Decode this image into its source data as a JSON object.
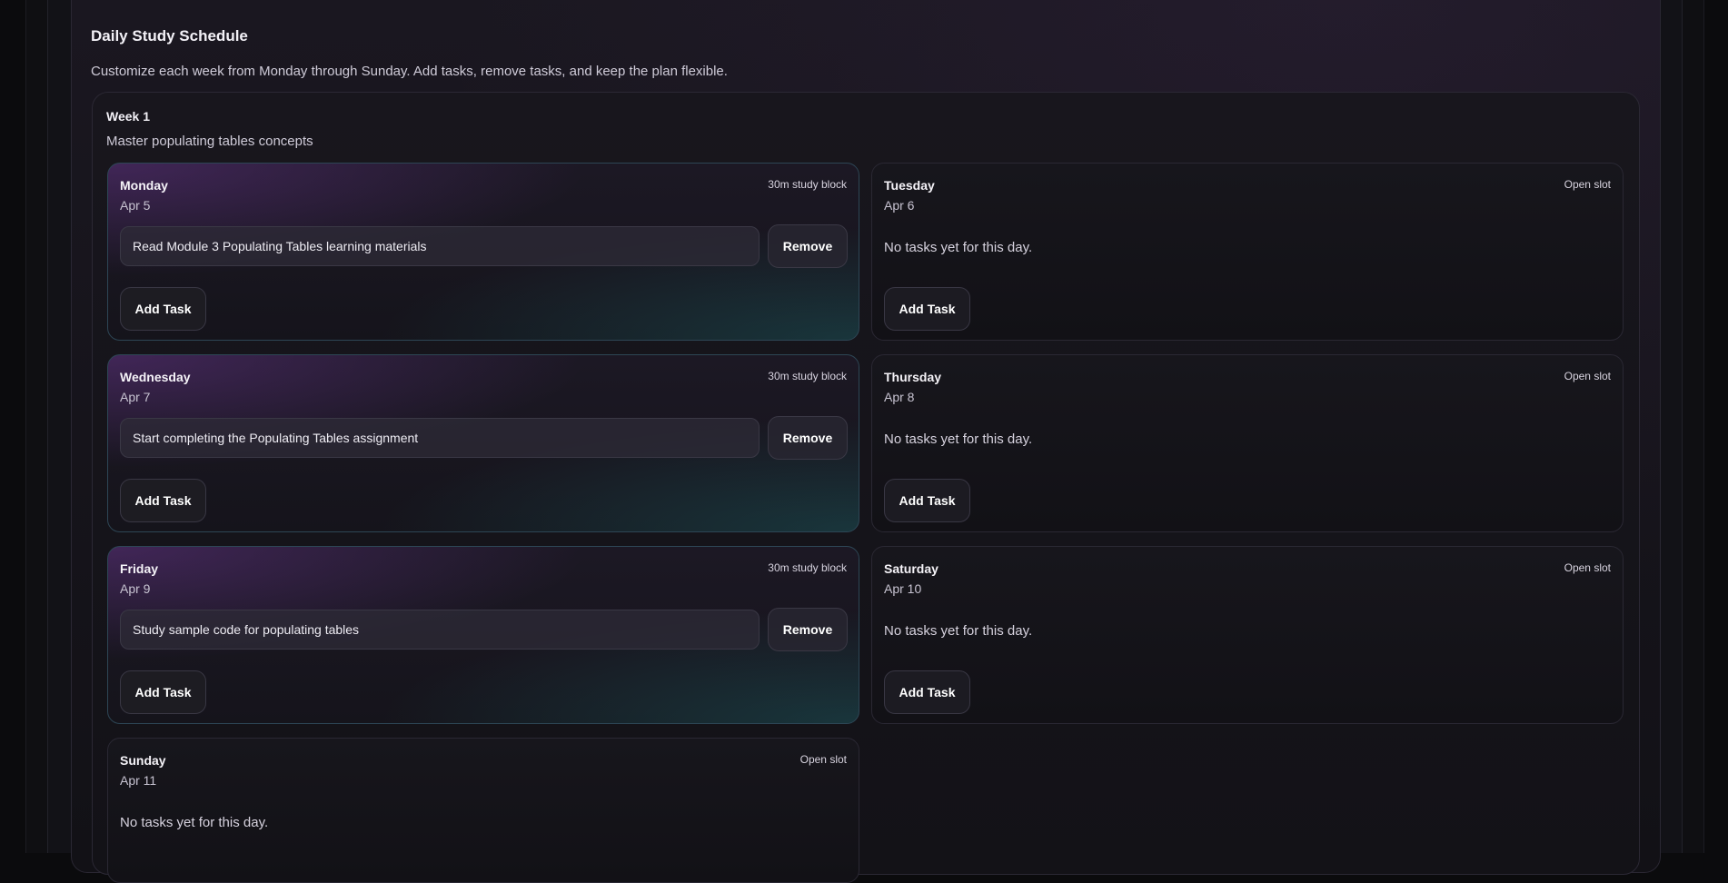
{
  "schedule": {
    "title": "Daily Study Schedule",
    "description": "Customize each week from Monday through Sunday. Add tasks, remove tasks, and keep the plan flexible."
  },
  "week": {
    "title": "Week 1",
    "goal": "Master populating tables concepts",
    "remove_label": "Remove",
    "add_label": "Add Task",
    "empty_text": "No tasks yet for this day.",
    "days": {
      "monday": {
        "name": "Monday",
        "date": "Apr 5",
        "badge": "30m study block",
        "task": "Read Module 3 Populating Tables learning materials"
      },
      "tuesday": {
        "name": "Tuesday",
        "date": "Apr 6",
        "badge": "Open slot"
      },
      "wednesday": {
        "name": "Wednesday",
        "date": "Apr 7",
        "badge": "30m study block",
        "task": "Start completing the Populating Tables assignment"
      },
      "thursday": {
        "name": "Thursday",
        "date": "Apr 8",
        "badge": "Open slot"
      },
      "friday": {
        "name": "Friday",
        "date": "Apr 9",
        "badge": "30m study block",
        "task": "Study sample code for populating tables"
      },
      "saturday": {
        "name": "Saturday",
        "date": "Apr 10",
        "badge": "Open slot"
      },
      "sunday": {
        "name": "Sunday",
        "date": "Apr 11",
        "badge": "Open slot"
      }
    }
  }
}
